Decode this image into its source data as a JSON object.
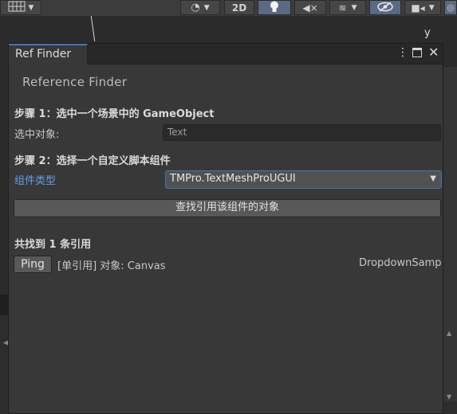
{
  "editor_toolbar": {
    "toggle_2d_label": "2D",
    "gizmo_axis_label": "y"
  },
  "window": {
    "tab_title": "Ref Finder",
    "header": "Reference Finder",
    "step1": {
      "title": "步骤 1：选中一个场景中的 GameObject",
      "selected_label": "选中对象:",
      "selected_value": "Text"
    },
    "step2": {
      "title": "步骤 2：选择一个自定义脚本组件",
      "component_type_label": "组件类型",
      "component_type_value": "TMPro.TextMeshProUGUI"
    },
    "find_button_label": "查找引用该组件的对象",
    "results": {
      "title": "共找到 1 条引用",
      "items": [
        {
          "ping_label": "Ping",
          "description": "[单引用] 对象: Canvas",
          "scene": "DropdownSamp"
        }
      ]
    }
  },
  "icons": {
    "menu": "kebab-menu-icon",
    "maximize": "maximize-icon",
    "close": "close-icon"
  },
  "colors": {
    "accent": "#3a79bb",
    "label_blue": "#5ea2e8",
    "window_bg": "#383838"
  }
}
